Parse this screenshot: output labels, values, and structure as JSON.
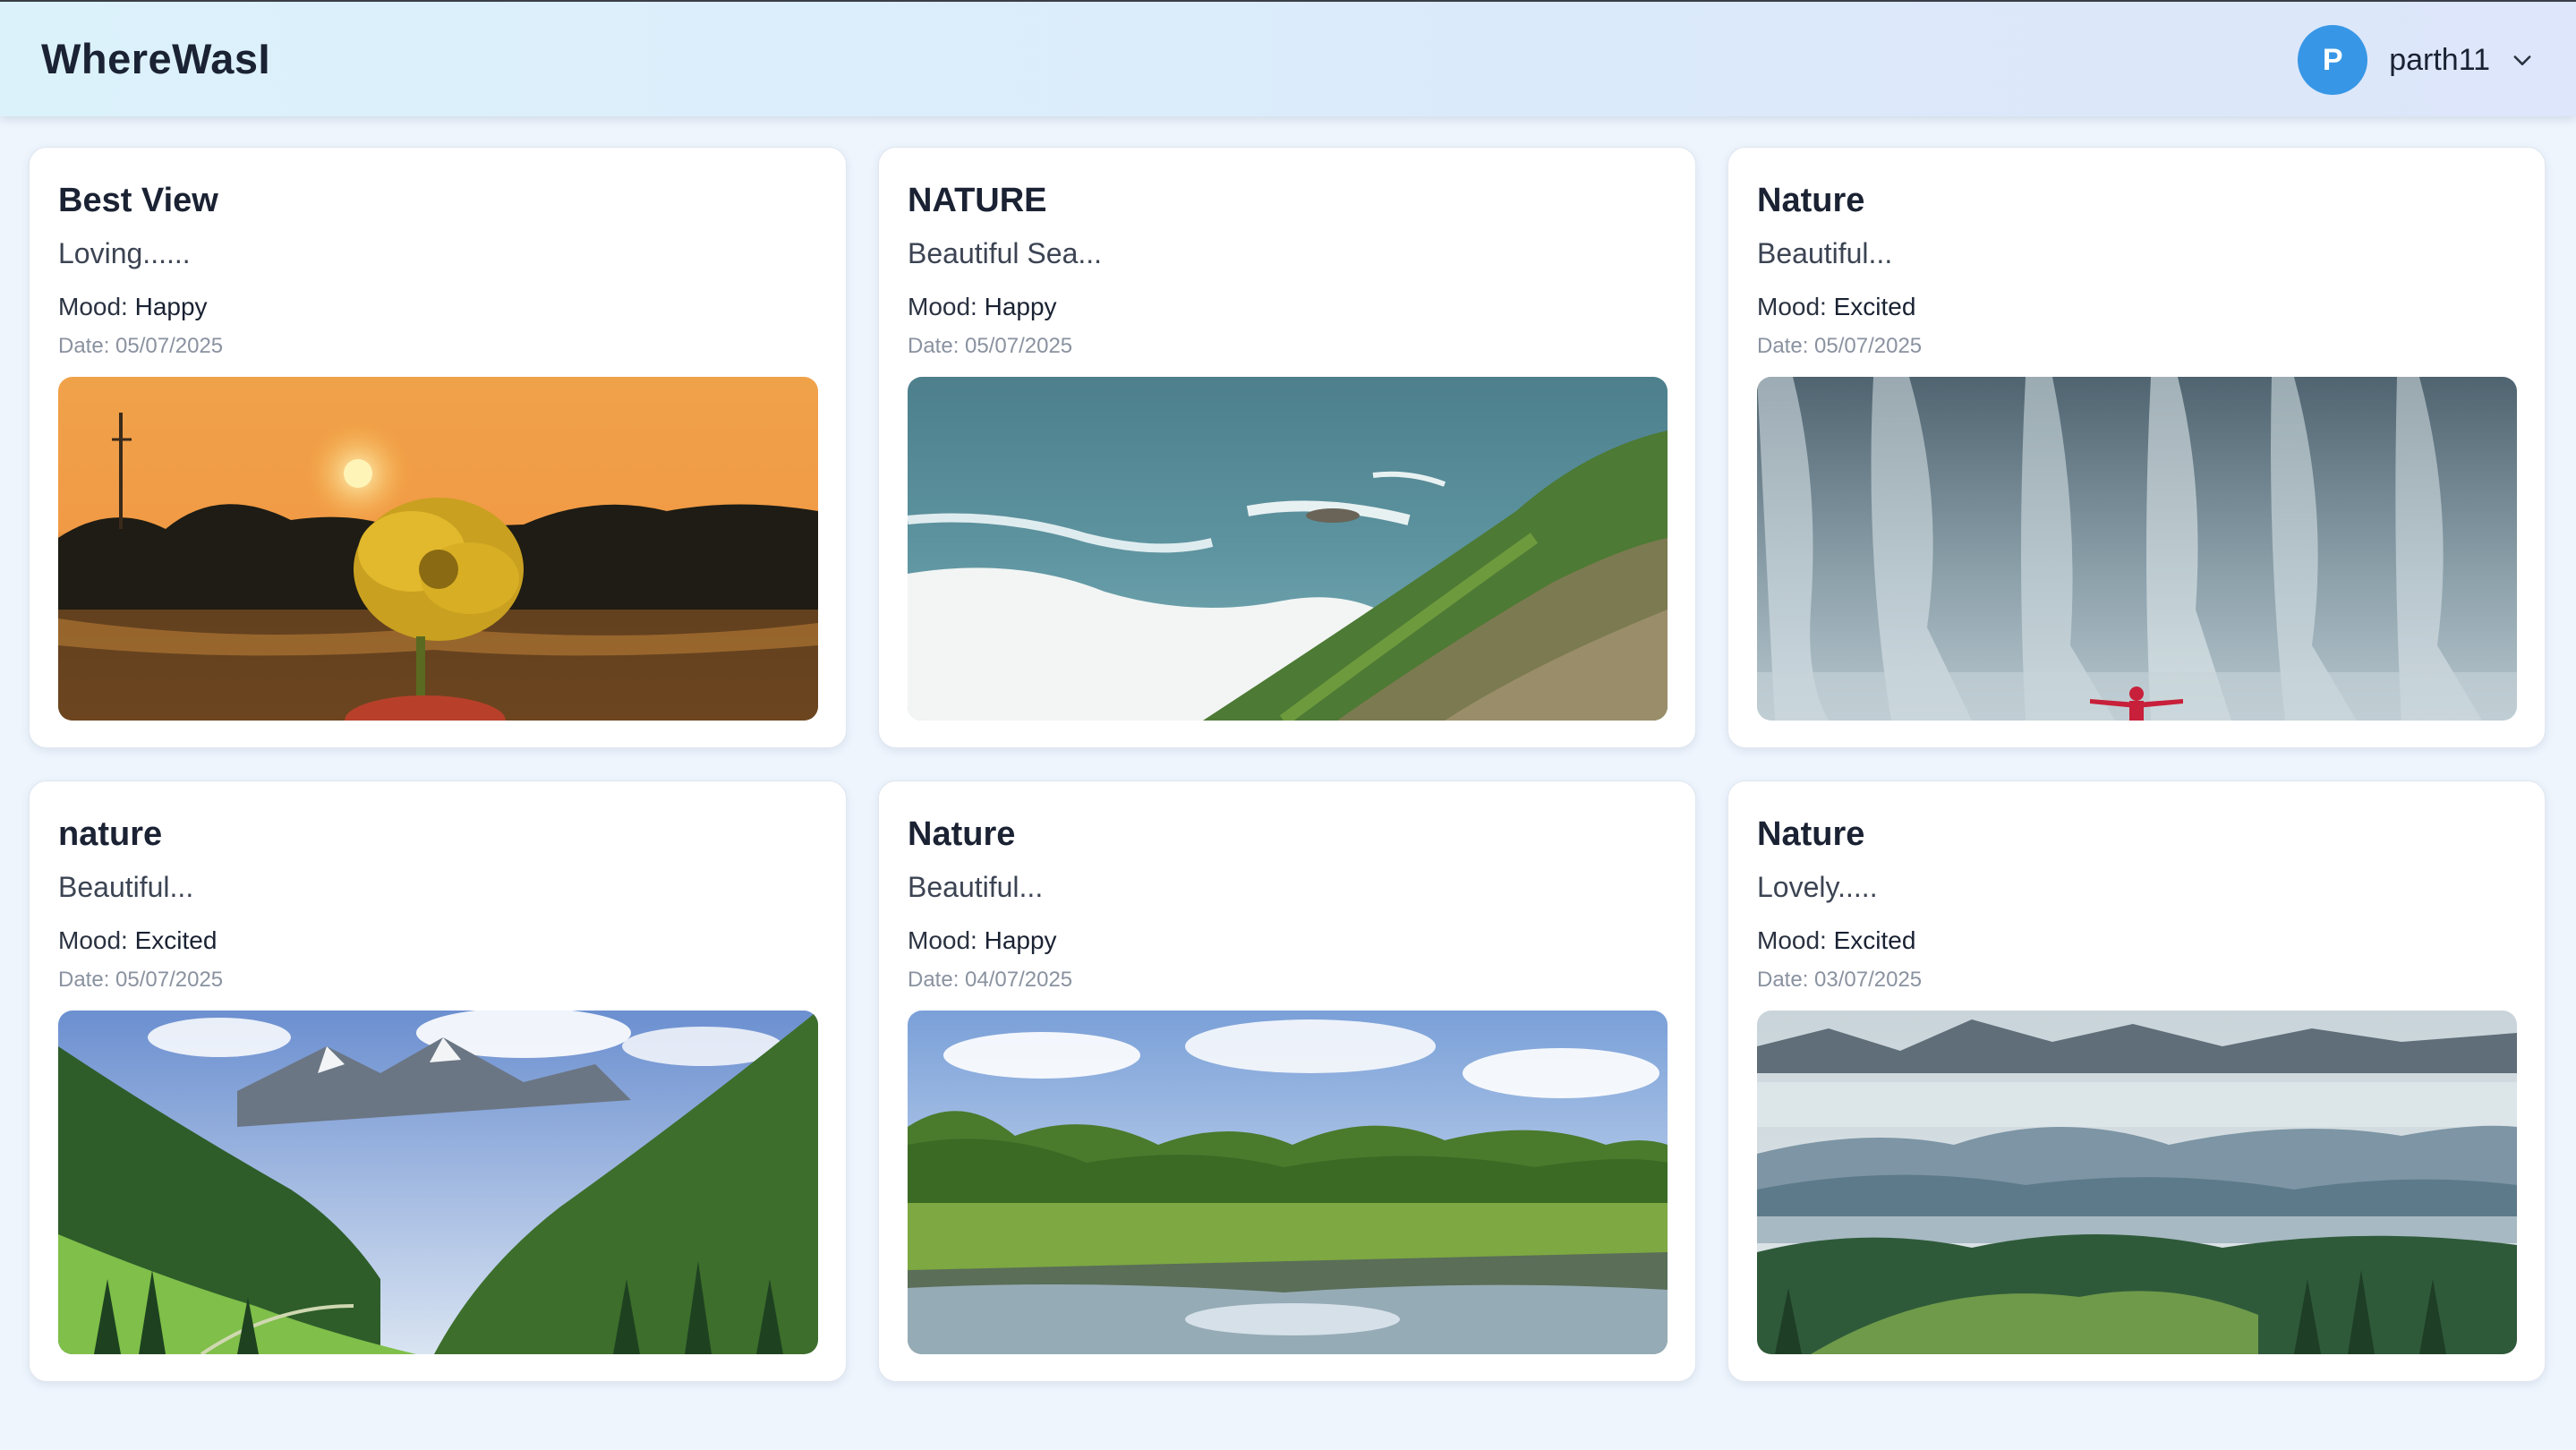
{
  "app": {
    "title": "WhereWasI"
  },
  "user": {
    "avatar_initial": "P",
    "name": "parth11"
  },
  "labels": {
    "mood_prefix": "Mood: ",
    "date_prefix": "Date: "
  },
  "entries": [
    {
      "title": "Best View",
      "description": "Loving......",
      "mood": "Happy",
      "date": "05/07/2025",
      "image": "sunset-flower-photo"
    },
    {
      "title": "NATURE",
      "description": "Beautiful Sea...",
      "mood": "Happy",
      "date": "05/07/2025",
      "image": "sea-cliff-photo"
    },
    {
      "title": "Nature",
      "description": "Beautiful...",
      "mood": "Excited",
      "date": "05/07/2025",
      "image": "waterfall-photo"
    },
    {
      "title": "nature",
      "description": "Beautiful...",
      "mood": "Excited",
      "date": "05/07/2025",
      "image": "mountain-valley-photo"
    },
    {
      "title": "Nature",
      "description": "Beautiful...",
      "mood": "Happy",
      "date": "04/07/2025",
      "image": "meadow-pond-photo"
    },
    {
      "title": "Nature",
      "description": "Lovely.....",
      "mood": "Excited",
      "date": "03/07/2025",
      "image": "misty-hills-photo"
    }
  ]
}
